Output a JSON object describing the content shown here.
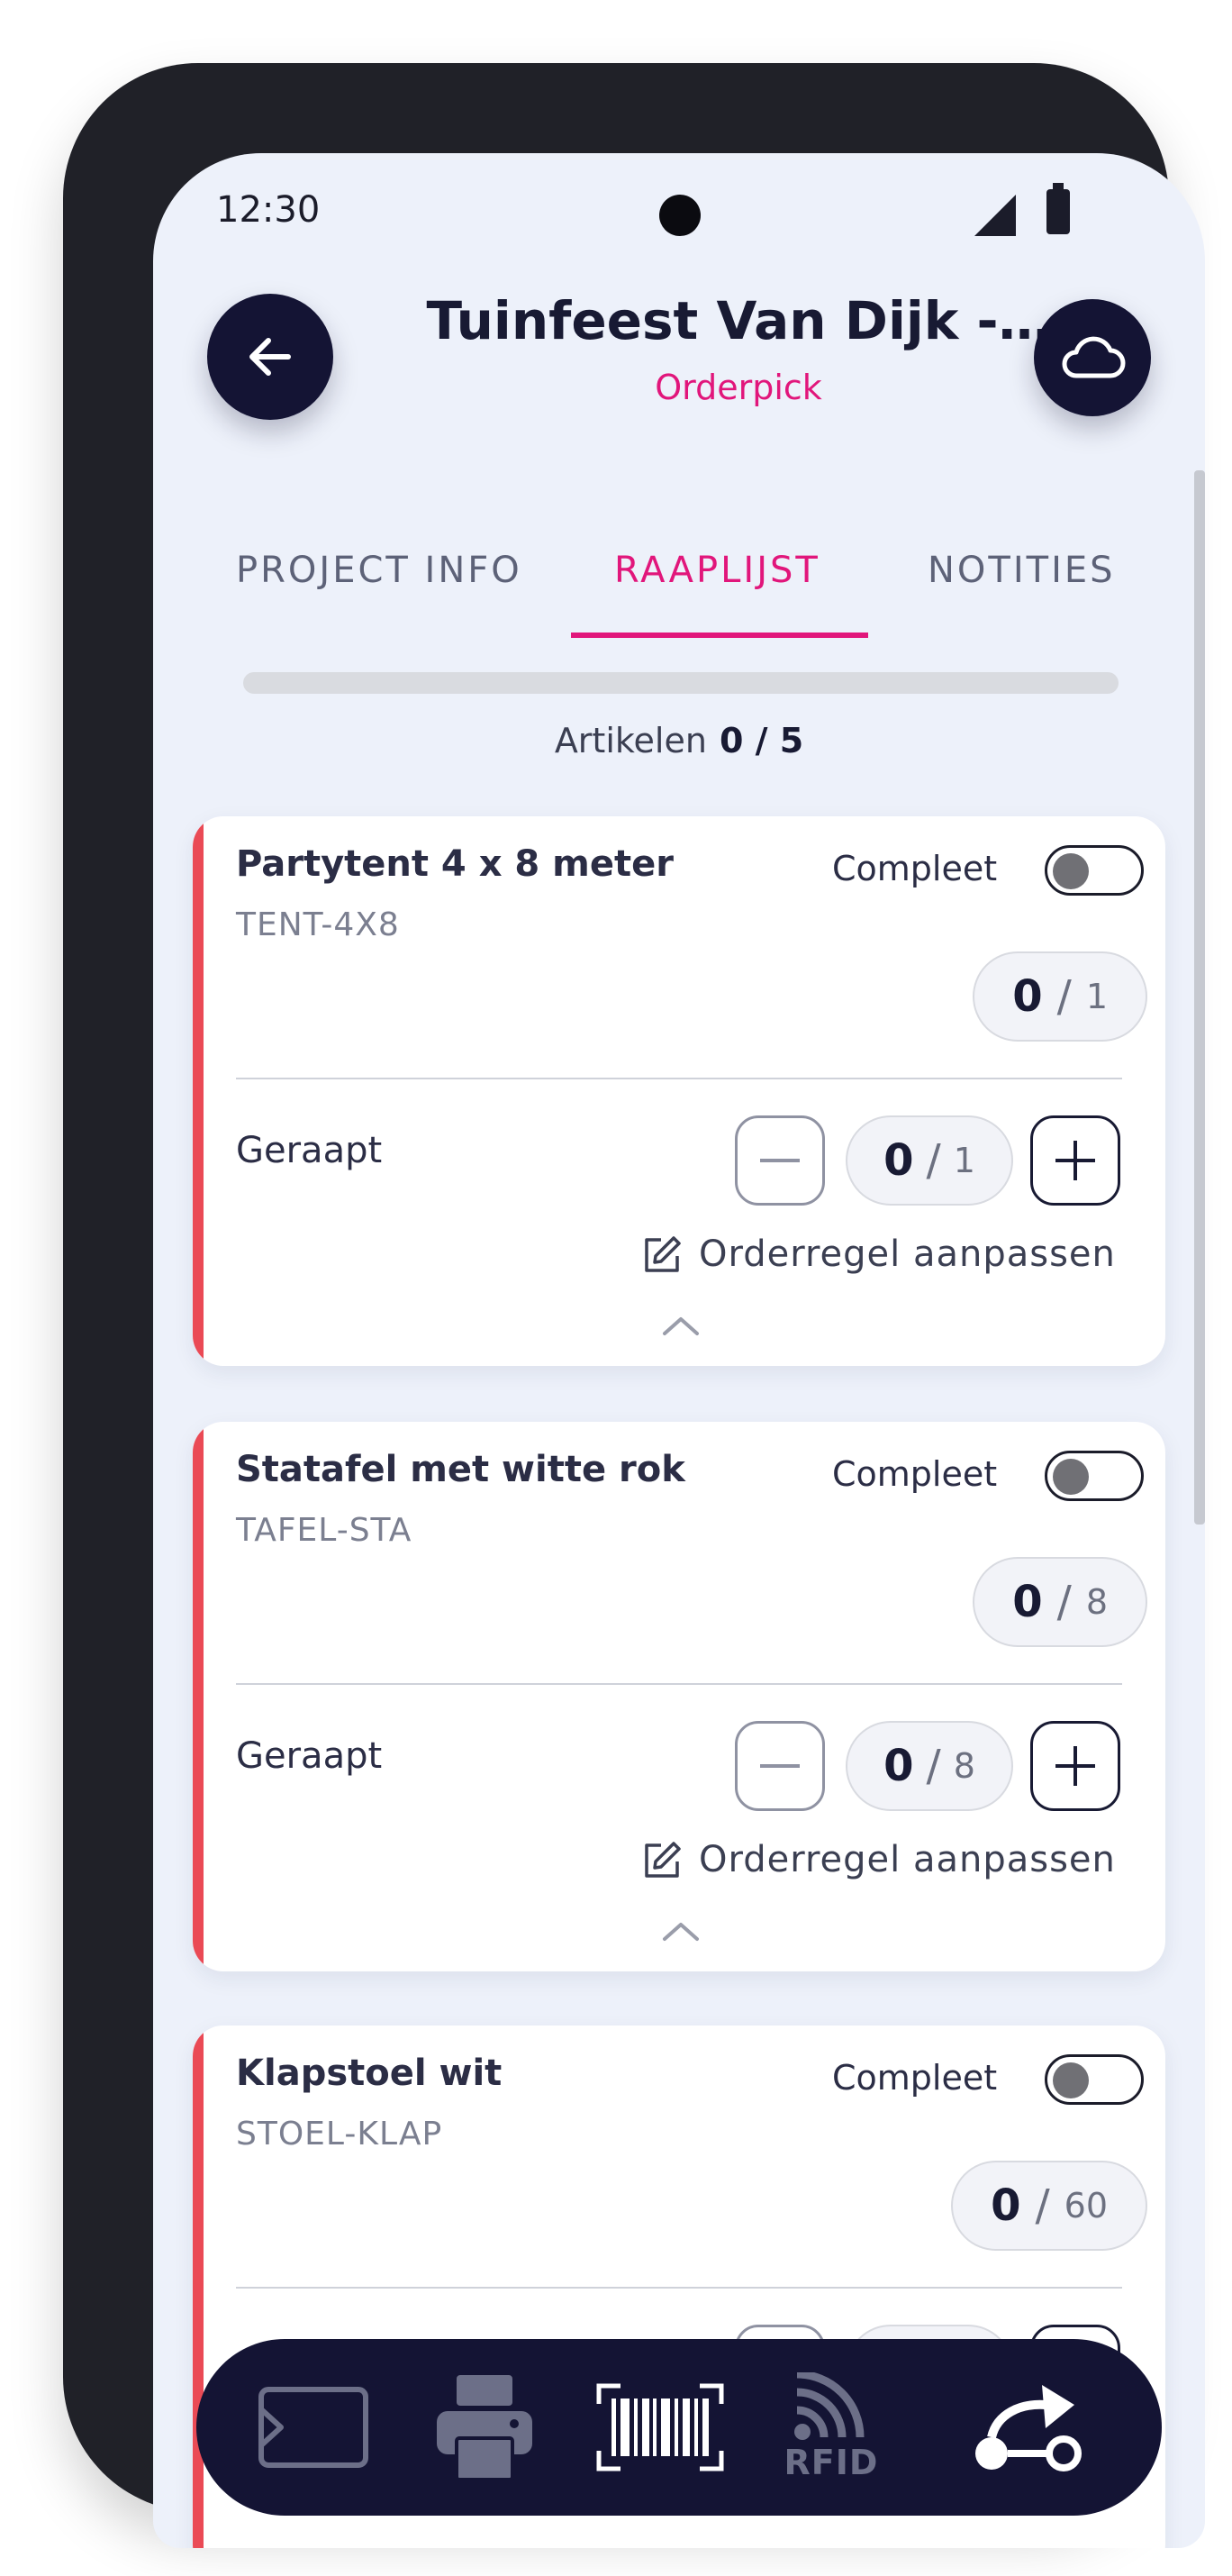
{
  "status_bar": {
    "time": "12:30"
  },
  "header": {
    "title": "Tuinfeest Van Dijk -…",
    "subtitle": "Orderpick",
    "back_icon": "arrow-left-icon",
    "cloud_icon": "cloud-icon"
  },
  "tabs": [
    {
      "label": "PROJECT INFO",
      "active": false
    },
    {
      "label": "RAAPLIJST",
      "active": true
    },
    {
      "label": "NOTITIES",
      "active": false
    }
  ],
  "progress": {
    "label": "Artikelen",
    "value": "0 / 5",
    "fraction": 0
  },
  "colors": {
    "accent": "#e1167b",
    "navy": "#141434",
    "incomplete_marker": "#ea4a55"
  },
  "labels": {
    "complete": "Compleet",
    "picked": "Geraapt",
    "edit": "Orderregel aanpassen"
  },
  "items": [
    {
      "name": "Partytent 4 x 8 meter",
      "sku": "TENT-4X8",
      "picked": "0",
      "total": "1",
      "complete": false
    },
    {
      "name": "Statafel met witte rok",
      "sku": "TAFEL-STA",
      "picked": "0",
      "total": "8",
      "complete": false
    },
    {
      "name": "Klapstoel wit",
      "sku": "STOEL-KLAP",
      "picked": "0",
      "total": "60",
      "complete": false
    }
  ],
  "bottom_nav": {
    "rfid_label": "RFID",
    "icons": [
      "nfc-tag-icon",
      "printer-icon",
      "barcode-scanner-icon",
      "rfid-icon",
      "route-icon"
    ]
  }
}
